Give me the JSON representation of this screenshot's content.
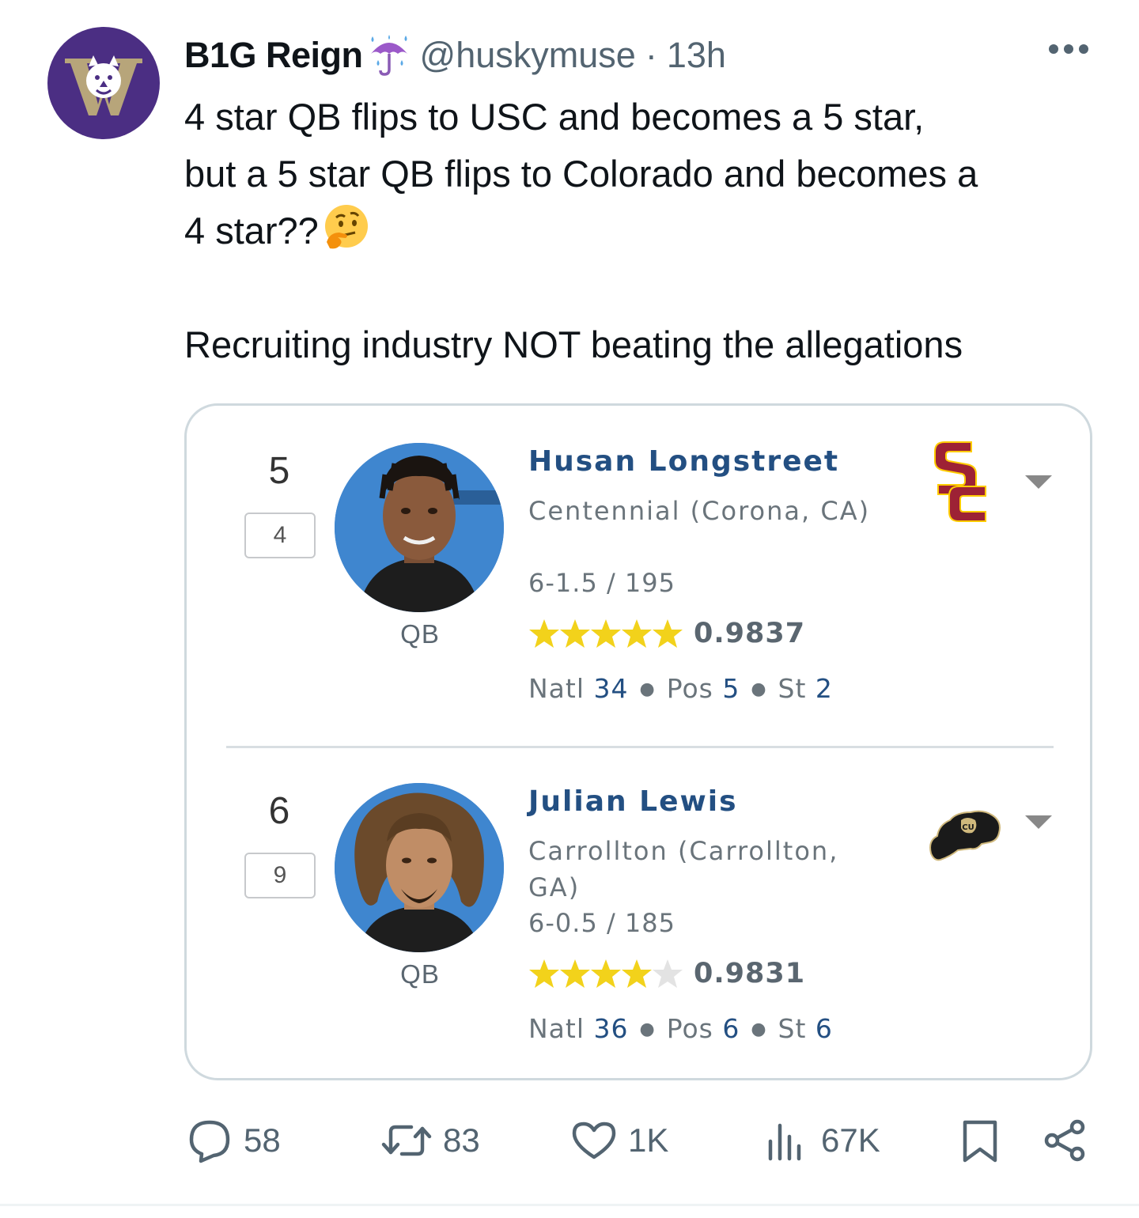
{
  "author": {
    "display_name": "B1G Reign",
    "handle": "@huskymuse",
    "separator": "·",
    "time": "13h"
  },
  "tweet": {
    "line1": "4 star QB flips to USC and becomes a 5 star,",
    "line2": "but a 5 star QB flips to Colorado and becomes a",
    "line3": "4 star??",
    "line4": "Recruiting industry NOT beating the allegations"
  },
  "players": [
    {
      "rank": "5",
      "prev_rank": "4",
      "position": "QB",
      "name": "Husan Longstreet",
      "school": "Centennial (Corona, CA)",
      "height_weight": "6-1.5 / 195",
      "stars": 5,
      "rating": "0.9837",
      "natl_label": "Natl",
      "natl": "34",
      "pos_label": "Pos",
      "pos": "5",
      "st_label": "St",
      "st": "2",
      "commit_icon": "usc-logo-icon"
    },
    {
      "rank": "6",
      "prev_rank": "9",
      "position": "QB",
      "name": "Julian Lewis",
      "school": "Carrollton (Carrollton, GA)",
      "height_weight": "6-0.5 / 185",
      "stars": 4,
      "rating": "0.9831",
      "natl_label": "Natl",
      "natl": "36",
      "pos_label": "Pos",
      "pos": "6",
      "st_label": "St",
      "st": "6",
      "commit_icon": "colorado-buffalo-logo-icon"
    }
  ],
  "actions": {
    "replies": "58",
    "reposts": "83",
    "likes": "1K",
    "views": "67K"
  },
  "colors": {
    "avatar_bg": "#4b2e83",
    "star_gold": "#f2d21b",
    "name_blue": "#234f82",
    "usc_cardinal": "#9d2235",
    "usc_gold": "#ffcc00"
  }
}
